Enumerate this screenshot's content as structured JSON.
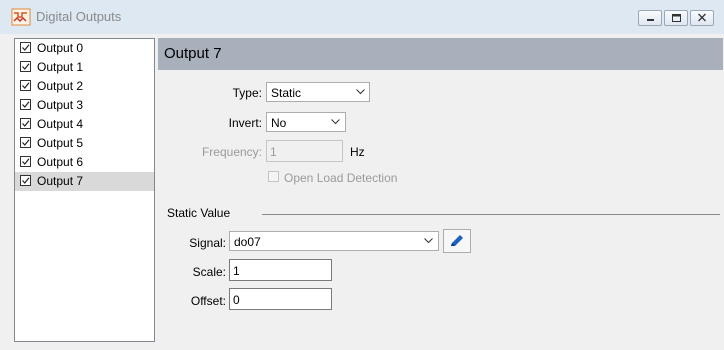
{
  "window": {
    "title": "Digital Outputs"
  },
  "outputs": {
    "items": [
      {
        "label": "Output 0",
        "checked": true
      },
      {
        "label": "Output 1",
        "checked": true
      },
      {
        "label": "Output 2",
        "checked": true
      },
      {
        "label": "Output 3",
        "checked": true
      },
      {
        "label": "Output 4",
        "checked": true
      },
      {
        "label": "Output 5",
        "checked": true
      },
      {
        "label": "Output 6",
        "checked": true
      },
      {
        "label": "Output 7",
        "checked": true
      }
    ],
    "selected_index": 7
  },
  "detail": {
    "header": "Output 7",
    "type": {
      "label": "Type:",
      "value": "Static"
    },
    "invert": {
      "label": "Invert:",
      "value": "No"
    },
    "frequency": {
      "label": "Frequency:",
      "value": "1",
      "unit": "Hz",
      "enabled": false
    },
    "open_load": {
      "label": "Open Load Detection",
      "checked": false,
      "enabled": false
    },
    "static_value": {
      "group_label": "Static Value",
      "signal": {
        "label": "Signal:",
        "value": "do07"
      },
      "scale": {
        "label": "Scale:",
        "value": "1"
      },
      "offset": {
        "label": "Offset:",
        "value": "0"
      }
    }
  },
  "colors": {
    "header_bg": "#a8b0bb",
    "titlebar_bg": "#dde8f3",
    "selected_row": "#d9d9d9",
    "edit_icon": "#1f5fbf"
  }
}
